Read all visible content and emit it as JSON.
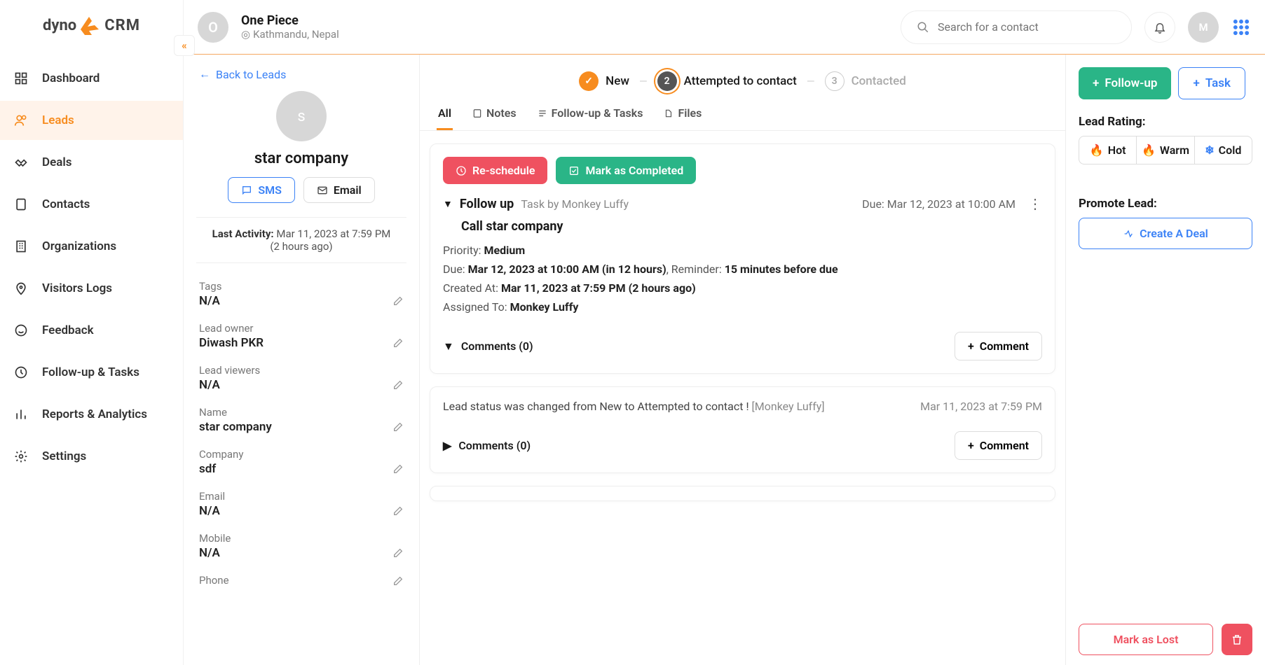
{
  "sidebar": {
    "items": [
      {
        "label": "Dashboard",
        "icon": "grid"
      },
      {
        "label": "Leads",
        "icon": "users",
        "active": true
      },
      {
        "label": "Deals",
        "icon": "handshake"
      },
      {
        "label": "Contacts",
        "icon": "book"
      },
      {
        "label": "Organizations",
        "icon": "building"
      },
      {
        "label": "Visitors Logs",
        "icon": "pin"
      },
      {
        "label": "Feedback",
        "icon": "smile"
      },
      {
        "label": "Follow-up & Tasks",
        "icon": "clock"
      },
      {
        "label": "Reports & Analytics",
        "icon": "bars"
      },
      {
        "label": "Settings",
        "icon": "gear"
      }
    ]
  },
  "topbar": {
    "org_initial": "O",
    "org_name": "One Piece",
    "location": "Kathmandu, Nepal",
    "search_placeholder": "Search for a contact",
    "user_initial": "M"
  },
  "detail": {
    "back_label": "Back to Leads",
    "avatar_initial": "s",
    "lead_name": "star company",
    "sms_label": "SMS",
    "email_label": "Email",
    "last_activity_label": "Last Activity:",
    "last_activity_value": "Mar 11, 2023 at 7:59 PM (2 hours ago)",
    "fields": [
      {
        "label": "Tags",
        "value": "N/A"
      },
      {
        "label": "Lead owner",
        "value": "Diwash PKR"
      },
      {
        "label": "Lead viewers",
        "value": "N/A"
      },
      {
        "label": "Name",
        "value": "star company"
      },
      {
        "label": "Company",
        "value": "sdf"
      },
      {
        "label": "Email",
        "value": "N/A"
      },
      {
        "label": "Mobile",
        "value": "N/A"
      },
      {
        "label": "Phone",
        "value": ""
      }
    ]
  },
  "stages": [
    {
      "num": "✓",
      "label": "New",
      "state": "done"
    },
    {
      "num": "2",
      "label": "Attempted to contact",
      "state": "current"
    },
    {
      "num": "3",
      "label": "Contacted",
      "state": "pending"
    }
  ],
  "tabs": [
    {
      "label": "All",
      "active": true
    },
    {
      "label": "Notes"
    },
    {
      "label": "Follow-up & Tasks"
    },
    {
      "label": "Files"
    }
  ],
  "task_card": {
    "reschedule_label": "Re-schedule",
    "complete_label": "Mark as Completed",
    "title": "Follow up",
    "by_prefix": "Task by ",
    "by": "Monkey Luffy",
    "due_short": "Due: Mar 12, 2023 at 10:00 AM",
    "subject": "Call star company",
    "priority_label": "Priority: ",
    "priority": "Medium",
    "due_label": "Due: ",
    "due_full": "Mar 12, 2023 at 10:00 AM (in 12 hours)",
    "reminder_label": ", Reminder: ",
    "reminder": "15 minutes before due",
    "created_label": "Created At: ",
    "created": "Mar 11, 2023 at 7:59 PM (2 hours ago)",
    "assigned_label": "Assigned To: ",
    "assigned": "Monkey Luffy",
    "comments_label": "Comments (0)",
    "comment_btn": "Comment"
  },
  "activity_card": {
    "text_a": "Lead status was changed from New to Attempted to contact !",
    "text_b": "[Monkey Luffy]",
    "time": "Mar 11, 2023 at 7:59 PM",
    "comments_label": "Comments (0)",
    "comment_btn": "Comment"
  },
  "actions": {
    "followup_label": "Follow-up",
    "task_label": "Task",
    "rating_title": "Lead Rating:",
    "ratings": [
      "Hot",
      "Warm",
      "Cold"
    ],
    "promote_title": "Promote Lead:",
    "create_deal_label": "Create A Deal",
    "mark_lost_label": "Mark as Lost"
  }
}
